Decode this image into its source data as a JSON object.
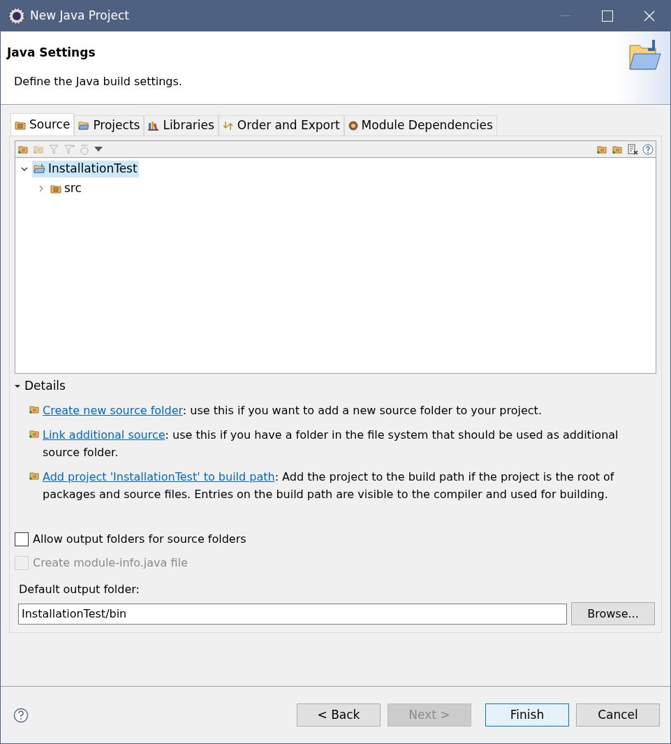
{
  "window": {
    "title": "New Java Project"
  },
  "header": {
    "title": "Java Settings",
    "description": "Define the Java build settings."
  },
  "tabs": [
    {
      "label": "Source",
      "selected": true,
      "kind": "source"
    },
    {
      "label": "Projects",
      "selected": false,
      "kind": "projects"
    },
    {
      "label": "Libraries",
      "selected": false,
      "kind": "libraries"
    },
    {
      "label": "Order and Export",
      "selected": false,
      "kind": "order"
    },
    {
      "label": "Module Dependencies",
      "selected": false,
      "kind": "modules"
    }
  ],
  "tree": [
    {
      "label": "InstallationTest",
      "selected": true,
      "expanded": true,
      "kind": "project",
      "children": [
        {
          "label": "src",
          "selected": false,
          "expanded": false,
          "kind": "source"
        }
      ]
    }
  ],
  "details": {
    "label": "Details",
    "expanded": true,
    "items": [
      {
        "link": "Create new source folder",
        "text": ": use this if you want to add a new source folder to your project."
      },
      {
        "link": "Link additional source",
        "text": ": use this if you have a folder in the file system that should be used as additional source folder."
      },
      {
        "link": "Add project 'InstallationTest' to build path",
        "text": ": Add the project to the build path if the project is the root of packages and source files. Entries on the build path are visible to the compiler and used for building."
      }
    ]
  },
  "options": [
    {
      "label": "Allow output folders for source folders",
      "checked": false,
      "disabled": false
    },
    {
      "label": "Create module-info.java file",
      "checked": false,
      "disabled": true
    }
  ],
  "output_folder": {
    "label": "Default output folder:",
    "value": "InstallationTest/bin",
    "browse": "Browse..."
  },
  "buttons": [
    {
      "label": "< Back",
      "disabled": false,
      "default": false
    },
    {
      "label": "Next >",
      "disabled": true,
      "default": false
    },
    {
      "label": "Finish",
      "disabled": false,
      "default": true
    },
    {
      "label": "Cancel",
      "disabled": false,
      "default": false
    }
  ]
}
